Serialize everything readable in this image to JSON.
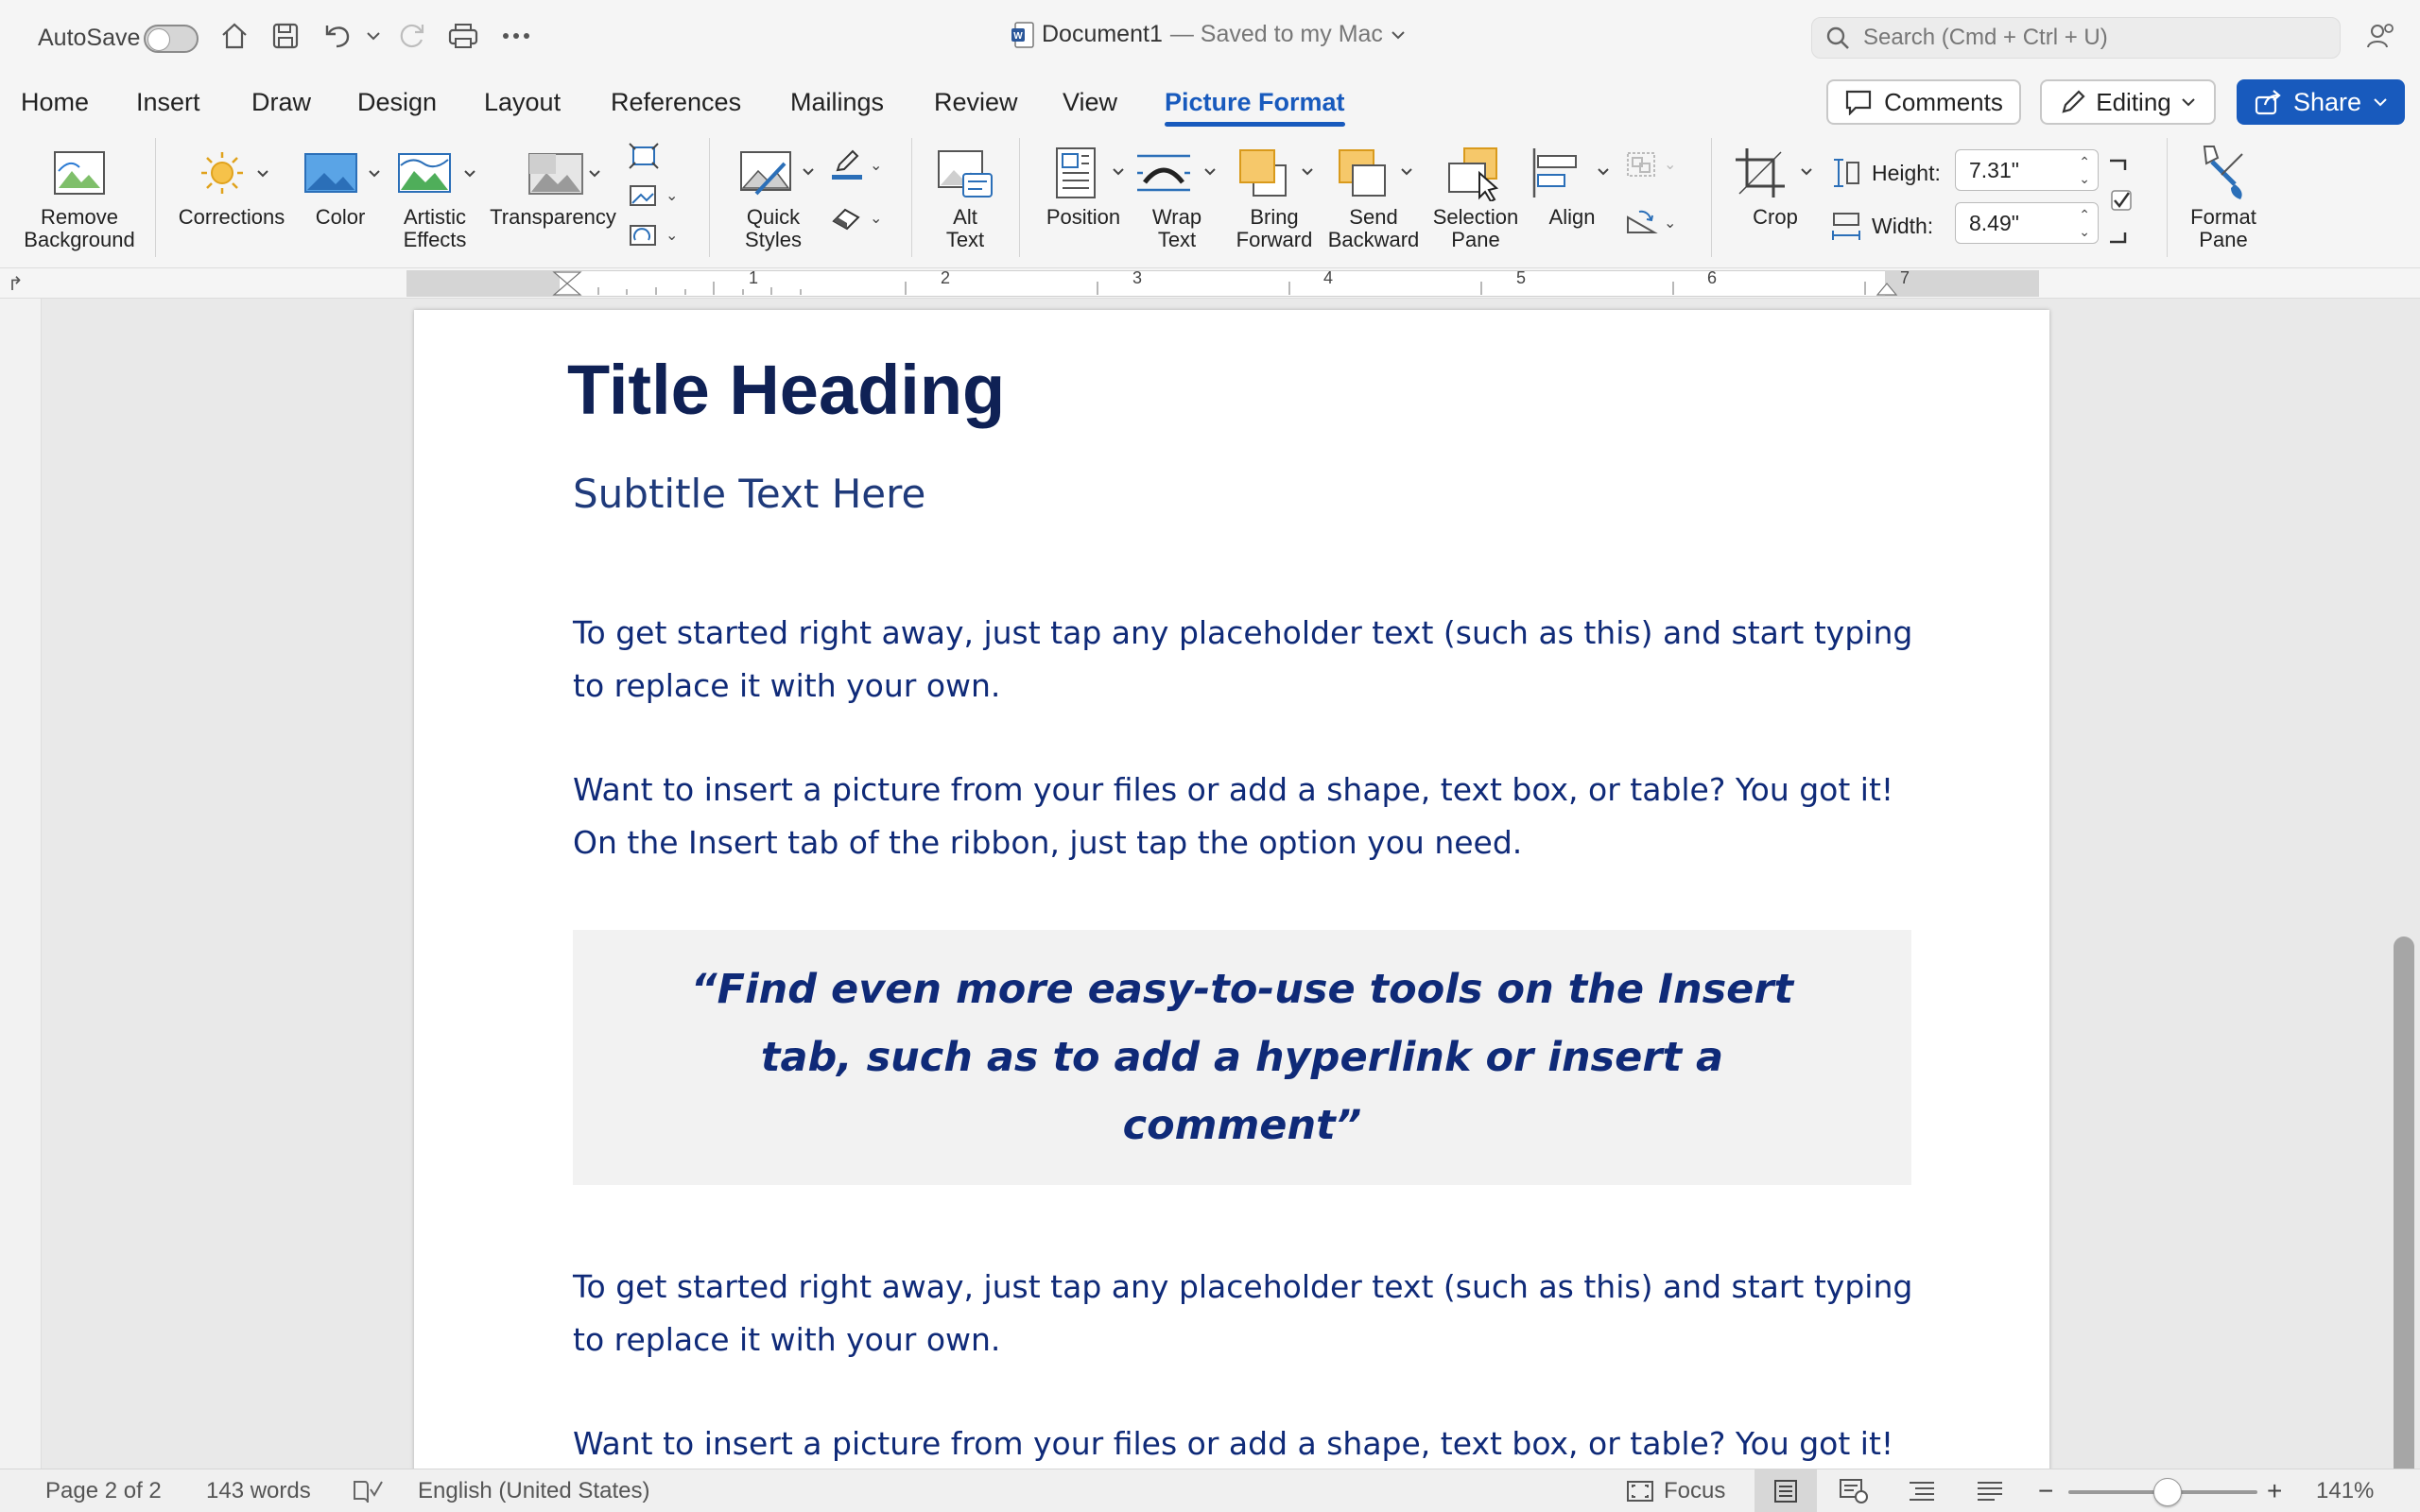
{
  "titlebar": {
    "autosave_label": "AutoSave",
    "doc_name": "Document1",
    "saved_status": "— Saved to my Mac",
    "search_placeholder": "Search (Cmd + Ctrl + U)"
  },
  "tabs": [
    {
      "label": "Home"
    },
    {
      "label": "Insert"
    },
    {
      "label": "Draw"
    },
    {
      "label": "Design"
    },
    {
      "label": "Layout"
    },
    {
      "label": "References"
    },
    {
      "label": "Mailings"
    },
    {
      "label": "Review"
    },
    {
      "label": "View"
    },
    {
      "label": "Picture Format",
      "active": true
    }
  ],
  "header_buttons": {
    "comments": "Comments",
    "editing": "Editing",
    "share": "Share"
  },
  "ribbon": {
    "remove_background": "Remove\nBackground",
    "corrections": "Corrections",
    "color": "Color",
    "artistic_effects": "Artistic\nEffects",
    "transparency": "Transparency",
    "quick_styles": "Quick\nStyles",
    "alt_text": "Alt\nText",
    "position": "Position",
    "wrap_text": "Wrap\nText",
    "bring_forward": "Bring\nForward",
    "send_backward": "Send\nBackward",
    "selection_pane": "Selection\nPane",
    "align": "Align",
    "crop": "Crop",
    "height_label": "Height:",
    "height_value": "7.31\"",
    "width_label": "Width:",
    "width_value": "8.49\"",
    "format_pane": "Format\nPane"
  },
  "ruler": {
    "numbers": [
      "1",
      "2",
      "3",
      "4",
      "5",
      "6",
      "7"
    ]
  },
  "document": {
    "title": "Title Heading",
    "subtitle": "Subtitle Text Here",
    "para1": "To get started right away, just tap any placeholder text (such as this) and start typing to replace it with your own.",
    "para2": "Want to insert a picture from your files or add a shape, text box, or table? You got it! On the Insert tab of the ribbon, just tap the option you need.",
    "quote": "“Find even more easy-to-use tools on the Insert tab, such as to add a hyperlink or insert a comment”",
    "para3": "To get started right away, just tap any placeholder text (such as this) and start typing to replace it with your own.",
    "para4": "Want to insert a picture from your files or add a shape, text box, or table? You got it!"
  },
  "statusbar": {
    "page": "Page 2 of 2",
    "words": "143 words",
    "language": "English (United States)",
    "focus": "Focus",
    "zoom": "141%"
  },
  "colors": {
    "accent": "#185abd",
    "heading": "#0f2155",
    "body_text": "#0f2a78"
  }
}
